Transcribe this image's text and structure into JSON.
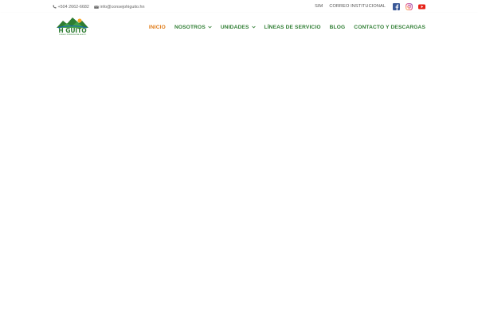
{
  "topbar": {
    "phone": "+504 2662-6682",
    "email": "info@consejohiguito.hn",
    "links": [
      "SIM",
      "CORREO INSTITUCIONAL"
    ],
    "social_icons": [
      "facebook-icon",
      "instagram-icon",
      "youtube-icon"
    ]
  },
  "logo": {
    "name": "H GUITO",
    "subtitle": "CONSEJO INTERMUNICIPAL HIGUITO"
  },
  "nav": {
    "items": [
      {
        "label": "INICIO",
        "dropdown": false,
        "active": true
      },
      {
        "label": "NOSOTROS",
        "dropdown": true,
        "active": false
      },
      {
        "label": "UNIDADES",
        "dropdown": true,
        "active": false
      },
      {
        "label": "LÍNEAS DE SERVICIO",
        "dropdown": false,
        "active": false
      },
      {
        "label": "BLOG",
        "dropdown": false,
        "active": false
      },
      {
        "label": "CONTACTO Y DESCARGAS",
        "dropdown": false,
        "active": false
      }
    ]
  },
  "colors": {
    "nav_green": "#2e7d32",
    "nav_active": "#e07b17",
    "facebook": "#3b5998",
    "instagram": "#d6249f",
    "youtube": "#e62117"
  }
}
